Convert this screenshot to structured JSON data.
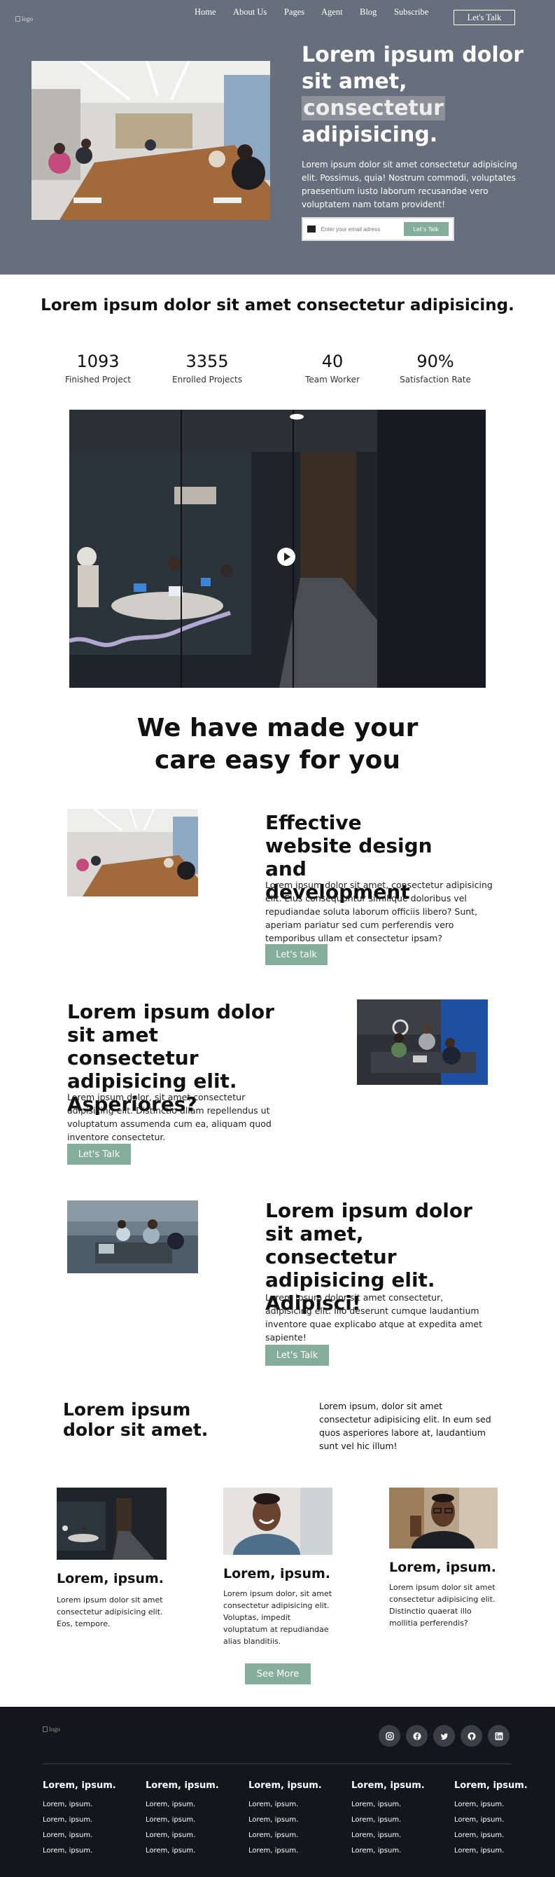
{
  "header": {
    "logo_alt": "logo",
    "nav": [
      "Home",
      "About Us",
      "Pages",
      "Agent",
      "Blog",
      "Subscribe"
    ],
    "cta": "Let's Talk"
  },
  "hero": {
    "title_line1": "Lorem ipsum dolor",
    "title_line2": "sit amet,",
    "title_highlight": "consectetur",
    "title_line4": "adipisicing.",
    "subtitle": "Lorem ipsum dolor sit amet consectetur adipisicing elit. Possimus, quia! Nostrum commodi, voluptates praesentium iusto laborum recusandae vero voluptatem nam totam provident!",
    "email_placeholder": "Enter your email adress",
    "submit": "Let's Talk"
  },
  "tagline": "Lorem ipsum dolor sit amet consectetur adipisicing.",
  "stats": [
    {
      "value": "1093",
      "label": "Finished Project"
    },
    {
      "value": "3355",
      "label": "Enrolled Projects"
    },
    {
      "value": "40",
      "label": "Team Worker"
    },
    {
      "value": "90%",
      "label": "Satisfaction Rate"
    }
  ],
  "care": {
    "line1": "We have made your",
    "line2": "care easy for you"
  },
  "features": [
    {
      "heading": "Effective website design and development",
      "text": "Lorem ipsum dolor sit amet, consectetur adipisicing elit. Eius consequuntur similique doloribus vel repudiandae soluta laborum officiis libero? Sunt, aperiam pariatur sed cum perferendis vero temporibus ullam et consectetur ipsam?",
      "button": "Let's talk"
    },
    {
      "heading": "Lorem ipsum dolor sit amet consectetur adipisicing elit. Asperiores?",
      "text": "Lorem ipsum dolor, sit amet consectetur adipisicing elit. Distinctio ullam repellendus ut voluptatum assumenda cum ea, aliquam quod inventore consectetur.",
      "button": "Let's Talk"
    },
    {
      "heading": "Lorem ipsum dolor sit amet, consectetur adipisicing elit. Adipisci!",
      "text": "Lorem ipsum dolor sit amet consectetur, adipisicing elit. Illo deserunt cumque laudantium inventore quae explicabo atque at expedita amet sapiente!",
      "button": "Let's Talk"
    }
  ],
  "split": {
    "heading": "Lorem ipsum dolor sit amet.",
    "text": "Lorem ipsum, dolor sit amet consectetur adipisicing elit. In eum sed quos asperiores labore at, laudantium sunt vel hic illum!"
  },
  "cards": [
    {
      "title": "Lorem, ipsum.",
      "text": "Lorem ipsum dolor sit amet consectetur adipisicing elit. Eos, tempore."
    },
    {
      "title": "Lorem, ipsum.",
      "text": "Lorem ipsum dolor, sit amet consectetur adipisicing elit. Voluptas, impedit voluptatum at repudiandae alias blanditiis."
    },
    {
      "title": "Lorem, ipsum.",
      "text": "Lorem ipsum dolor sit amet consectetur adipisicing elit. Distinctio quaerat illo mollitia perferendis?"
    }
  ],
  "see_more": "See More",
  "footer": {
    "logo_alt": "logo",
    "social_icons": [
      "instagram-icon",
      "facebook-icon",
      "twitter-icon",
      "github-icon",
      "linkedin-icon"
    ],
    "columns": [
      {
        "title": "Lorem, ipsum.",
        "links": [
          "Lorem, ipsum.",
          "Lorem, ipsum.",
          "Lorem, ipsum.",
          "Lorem, ipsum."
        ]
      },
      {
        "title": "Lorem, ipsum.",
        "links": [
          "Lorem, ipsum.",
          "Lorem, ipsum.",
          "Lorem, ipsum.",
          "Lorem, ipsum."
        ]
      },
      {
        "title": "Lorem, ipsum.",
        "links": [
          "Lorem, ipsum.",
          "Lorem, ipsum.",
          "Lorem, ipsum.",
          "Lorem, ipsum."
        ]
      },
      {
        "title": "Lorem, ipsum.",
        "links": [
          "Lorem, ipsum.",
          "Lorem, ipsum.",
          "Lorem, ipsum.",
          "Lorem, ipsum."
        ]
      },
      {
        "title": "Lorem, ipsum.",
        "links": [
          "Lorem, ipsum.",
          "Lorem, ipsum.",
          "Lorem, ipsum.",
          "Lorem, ipsum."
        ]
      }
    ]
  },
  "colors": {
    "hero_bg": "#666f7b",
    "accent": "#85ad9b",
    "footer_bg": "#13171c"
  }
}
